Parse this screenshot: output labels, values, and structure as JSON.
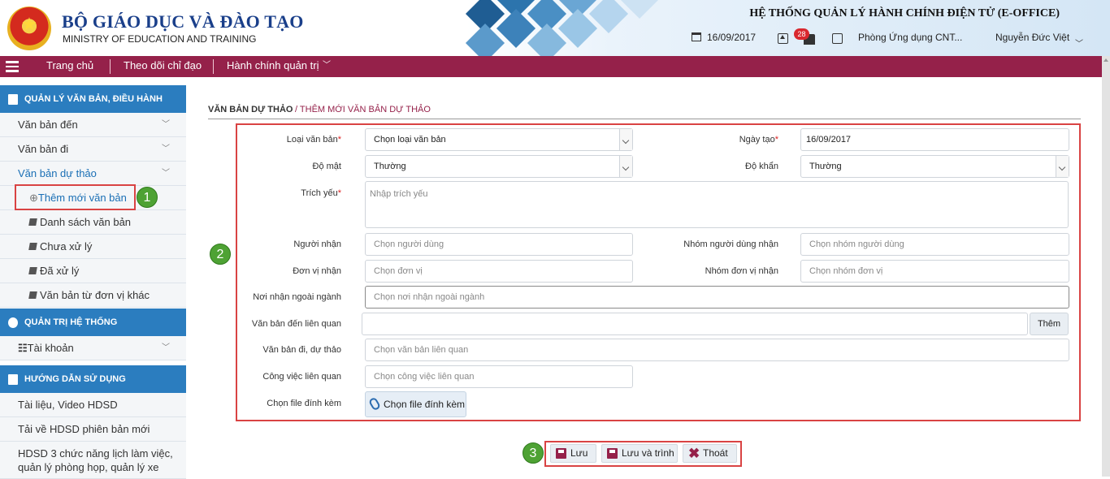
{
  "header": {
    "org_name_vn": "BỘ GIÁO DỤC VÀ ĐÀO TẠO",
    "org_name_en": "MINISTRY OF EDUCATION AND TRAINING",
    "system_title": "HỆ THỐNG QUẢN LÝ HÀNH CHÍNH ĐIỆN TỬ (E-OFFICE)",
    "date": "16/09/2017",
    "notification_count": "28",
    "department": "Phòng Ứng dụng CNT...",
    "user_name": "Nguyễn Đức Việt"
  },
  "nav": {
    "items": [
      {
        "label": "Trang chủ"
      },
      {
        "label": "Theo dõi chỉ đạo"
      },
      {
        "label": "Hành chính quản trị"
      }
    ]
  },
  "sidebar": {
    "section1": "QUẢN LÝ VĂN BẢN, ĐIỀU HÀNH",
    "items1": [
      {
        "label": "Văn bản đến"
      },
      {
        "label": "Văn bản đi"
      },
      {
        "label": "Văn bản dự thảo"
      },
      {
        "label": "Thêm mới văn bản"
      },
      {
        "label": "Danh sách văn bản"
      },
      {
        "label": "Chưa xử lý"
      },
      {
        "label": "Đã xử lý"
      },
      {
        "label": "Văn bản từ đơn vị khác"
      }
    ],
    "section2": "QUẢN TRỊ HỆ THỐNG",
    "items2": [
      {
        "label": "Tài khoản"
      }
    ],
    "section3": "HƯỚNG DẪN SỬ DỤNG",
    "items3": [
      {
        "label": "Tài liệu, Video HDSD"
      },
      {
        "label": "Tải về HDSD phiên bản mới"
      },
      {
        "label": "HDSD 3 chức năng lịch làm việc, quản lý phòng họp, quản lý xe"
      }
    ]
  },
  "breadcrumb": {
    "parent": "VĂN BẢN DỰ THẢO",
    "separator": " / ",
    "current": "THÊM MỚI VĂN BẢN DỰ THẢO"
  },
  "form": {
    "loai_van_ban": {
      "label": "Loại văn bản",
      "required": "*",
      "value": "Chọn loại văn bản"
    },
    "ngay_tao": {
      "label": "Ngày tạo",
      "required": "*",
      "value": "16/09/2017"
    },
    "do_mat": {
      "label": "Độ mật",
      "value": "Thường"
    },
    "do_khan": {
      "label": "Độ khẩn",
      "value": "Thường"
    },
    "trich_yeu": {
      "label": "Trích yếu",
      "required": "*",
      "placeholder": "Nhập trích yếu"
    },
    "nguoi_nhan": {
      "label": "Người nhận",
      "placeholder": "Chọn người dùng"
    },
    "nhom_nguoi_dung_nhan": {
      "label": "Nhóm người dùng nhận",
      "placeholder": "Chọn nhóm người dùng"
    },
    "don_vi_nhan": {
      "label": "Đơn vị nhận",
      "placeholder": "Chọn đơn vị"
    },
    "nhom_don_vi_nhan": {
      "label": "Nhóm đơn vị nhận",
      "placeholder": "Chọn nhóm đơn vị"
    },
    "noi_nhan_ngoai_nganh": {
      "label": "Nơi nhận ngoài ngành",
      "placeholder": "Chọn nơi nhận ngoài ngành"
    },
    "van_ban_den_lien_quan": {
      "label": "Văn bản đến liên quan",
      "button": "Thêm"
    },
    "van_ban_di_du_thao": {
      "label": "Văn bản đi, dự thảo",
      "placeholder": "Chọn văn bản liên quan"
    },
    "cong_viec_lien_quan": {
      "label": "Công việc liên quan",
      "placeholder": "Chọn công việc liên quan"
    },
    "file": {
      "label": "Chọn file đính kèm",
      "button": "Chọn file đính kèm"
    }
  },
  "actions": {
    "save": "Lưu",
    "save_submit": "Lưu và trình",
    "exit": "Thoát"
  },
  "callouts": [
    "1",
    "2",
    "3"
  ]
}
